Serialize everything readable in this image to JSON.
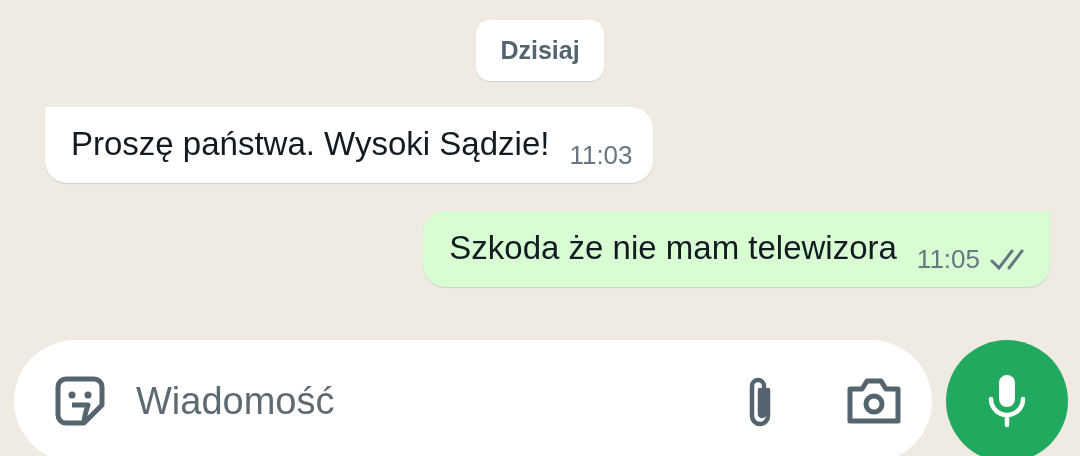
{
  "date_chip": "Dzisiaj",
  "messages": [
    {
      "kind": "incoming",
      "text": "Proszę państwa. Wysoki Sądzie!",
      "time": "11:03"
    },
    {
      "kind": "outgoing",
      "text": "Szkoda że nie mam telewizora",
      "time": "11:05",
      "read": false
    }
  ],
  "composer": {
    "placeholder": "Wiadomość"
  }
}
